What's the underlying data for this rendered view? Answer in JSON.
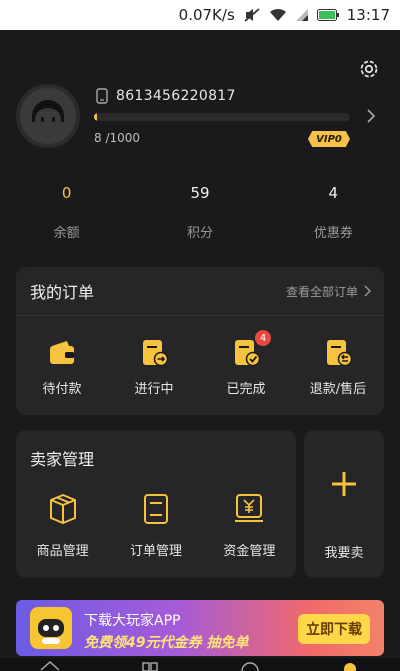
{
  "status_bar": {
    "speed": "0.07K/s",
    "time": "13:17"
  },
  "profile": {
    "phone": "8613456220817",
    "progress_text": "8 /1000",
    "progress_fraction": 0.008,
    "vip_label": "VIP0"
  },
  "stats": [
    {
      "value": "0",
      "label": "余额"
    },
    {
      "value": "59",
      "label": "积分"
    },
    {
      "value": "4",
      "label": "优惠券"
    }
  ],
  "orders": {
    "title": "我的订单",
    "view_all": "查看全部订单",
    "items": [
      {
        "label": "待付款",
        "icon": "wallet-icon"
      },
      {
        "label": "进行中",
        "icon": "order-progress-icon"
      },
      {
        "label": "已完成",
        "icon": "order-done-icon",
        "badge": "4"
      },
      {
        "label": "退款/售后",
        "icon": "refund-icon"
      }
    ]
  },
  "seller": {
    "title": "卖家管理",
    "items": [
      {
        "label": "商品管理",
        "icon": "box-icon"
      },
      {
        "label": "订单管理",
        "icon": "clipboard-icon"
      },
      {
        "label": "资金管理",
        "icon": "money-icon"
      }
    ]
  },
  "sell": {
    "label": "我要卖"
  },
  "banner": {
    "line1": "下载大玩家APP",
    "line2": "免费领49元代金券 抽免单",
    "button": "立即下载"
  },
  "colors": {
    "accent": "#f6c33e",
    "background": "#1a1a1c",
    "card": "#262628",
    "badge": "#e5493f"
  }
}
